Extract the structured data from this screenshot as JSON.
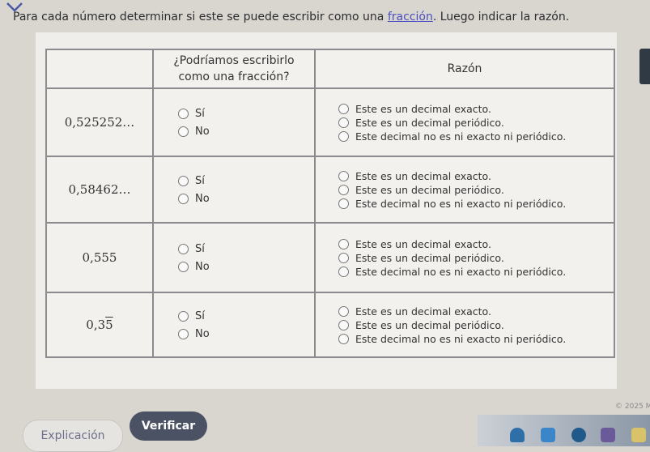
{
  "prompt": {
    "before": "Para cada número determinar si este se puede escribir como una ",
    "link": "fracción",
    "after": ". Luego indicar la razón."
  },
  "table": {
    "header_fraction": "¿Podríamos escribirlo como una fracción?",
    "header_reason": "Razón",
    "rows": [
      {
        "number": "0,525252…",
        "yes": "Sí",
        "no": "No",
        "r1": "Este es un decimal exacto.",
        "r2": "Este es un decimal periódico.",
        "r3": "Este decimal no es ni exacto ni periódico."
      },
      {
        "number": "0,58462…",
        "yes": "Sí",
        "no": "No",
        "r1": "Este es un decimal exacto.",
        "r2": "Este es un decimal periódico.",
        "r3": "Este decimal no es ni exacto ni periódico."
      },
      {
        "number": "0,555",
        "yes": "Sí",
        "no": "No",
        "r1": "Este es un decimal exacto.",
        "r2": "Este es un decimal periódico.",
        "r3": "Este decimal no es ni exacto ni periódico."
      },
      {
        "number_base": "0,3",
        "number_repeat": "5",
        "yes": "Sí",
        "no": "No",
        "r1": "Este es un decimal exacto.",
        "r2": "Este es un decimal periódico.",
        "r3": "Este decimal no es ni exacto ni periódico."
      }
    ]
  },
  "buttons": {
    "explanation": "Explicación",
    "verify": "Verificar"
  },
  "footer": {
    "copyright": "© 2025 M"
  },
  "colors": {
    "link": "#4a4fc0",
    "verify_bg": "#4a5264",
    "table_border": "#8b8a8f"
  }
}
